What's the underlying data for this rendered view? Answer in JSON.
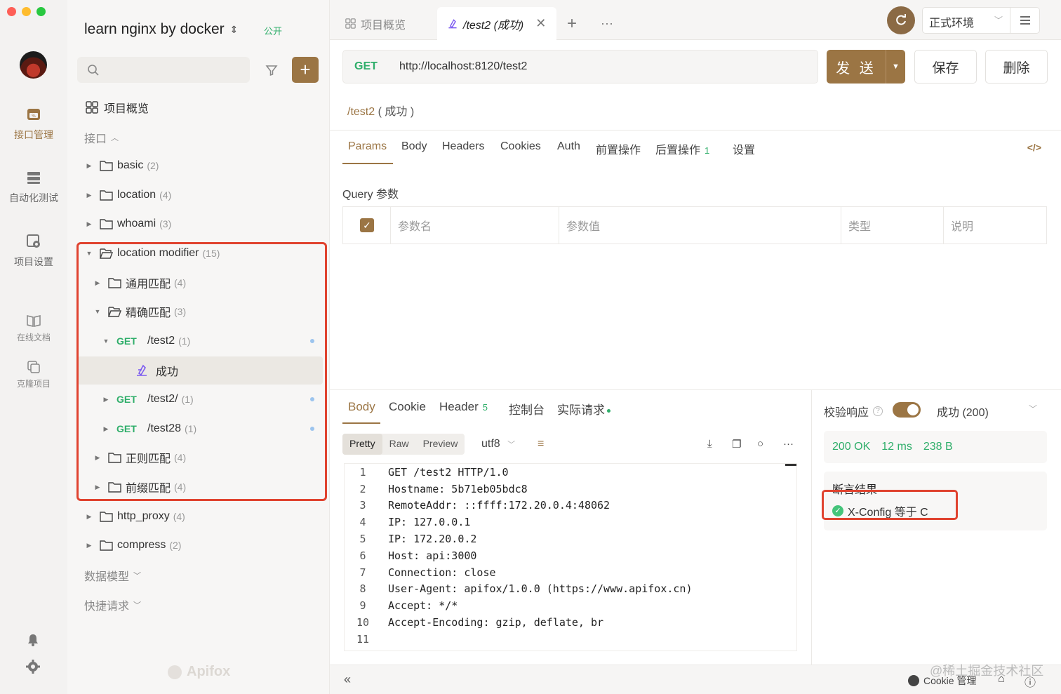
{
  "rail": {
    "items": [
      {
        "label": "接口管理",
        "icon": "api-management-icon",
        "active": true
      },
      {
        "label": "自动化测试",
        "icon": "automation-test-icon"
      },
      {
        "label": "项目设置",
        "icon": "project-settings-icon"
      },
      {
        "label": "在线文档",
        "icon": "online-docs-icon"
      },
      {
        "label": "克隆项目",
        "icon": "clone-project-icon"
      }
    ]
  },
  "sidebar": {
    "project_title": "learn nginx by docker",
    "visibility": "公开",
    "overview": "项目概览",
    "interfaces_label": "接口",
    "tree": [
      {
        "type": "folder",
        "name": "basic",
        "count": "(2)"
      },
      {
        "type": "folder",
        "name": "location",
        "count": "(4)"
      },
      {
        "type": "folder",
        "name": "whoami",
        "count": "(3)"
      },
      {
        "type": "folder",
        "name": "location modifier",
        "count": "(15)"
      },
      {
        "type": "folder",
        "name": "通用匹配",
        "count": "(4)"
      },
      {
        "type": "folder",
        "name": "精确匹配",
        "count": "(3)"
      },
      {
        "type": "api",
        "method": "GET",
        "name": "/test2",
        "count": "(1)"
      },
      {
        "type": "case",
        "name": "成功"
      },
      {
        "type": "api",
        "method": "GET",
        "name": "/test2/",
        "count": "(1)"
      },
      {
        "type": "api",
        "method": "GET",
        "name": "/test28",
        "count": "(1)"
      },
      {
        "type": "folder",
        "name": "正则匹配",
        "count": "(4)"
      },
      {
        "type": "folder",
        "name": "前缀匹配",
        "count": "(4)"
      },
      {
        "type": "folder",
        "name": "http_proxy",
        "count": "(4)"
      },
      {
        "type": "folder",
        "name": "compress",
        "count": "(2)"
      }
    ],
    "data_models": "数据模型",
    "quick_requests": "快捷请求",
    "brand": "Apifox"
  },
  "tabs": [
    {
      "label": "项目概览"
    },
    {
      "label": "/test2 (成功)"
    }
  ],
  "env": {
    "label": "正式环境"
  },
  "request": {
    "method": "GET",
    "url": "http://localhost:8120/test2",
    "send": "发 送",
    "save": "保存",
    "delete": "删除",
    "breadcrumb_path": "/test2",
    "breadcrumb_case": "( 成功 )",
    "tabs": [
      {
        "label": "Params"
      },
      {
        "label": "Body"
      },
      {
        "label": "Headers"
      },
      {
        "label": "Cookies"
      },
      {
        "label": "Auth"
      },
      {
        "label": "前置操作"
      },
      {
        "label": "后置操作",
        "badge": "1"
      },
      {
        "label": "设置"
      }
    ],
    "query_label": "Query 参数",
    "query_columns": [
      "参数名",
      "参数值",
      "类型",
      "说明"
    ]
  },
  "response": {
    "tabs": [
      {
        "label": "Body"
      },
      {
        "label": "Cookie"
      },
      {
        "label": "Header",
        "badge": "5"
      },
      {
        "label": "控制台"
      },
      {
        "label": "实际请求"
      }
    ],
    "formats": [
      "Pretty",
      "Raw",
      "Preview"
    ],
    "encoding": "utf8",
    "lines": [
      "GET /test2 HTTP/1.0",
      "Hostname: 5b71eb05bdc8",
      "RemoteAddr: ::ffff:172.20.0.4:48062",
      "IP: 127.0.0.1",
      "IP: 172.20.0.2",
      "Host: api:3000",
      "Connection: close",
      "User-Agent: apifox/1.0.0 (https://www.apifox.cn)",
      "Accept: */*",
      "Accept-Encoding: gzip, deflate, br",
      ""
    ],
    "verify_label": "校验响应",
    "status_select": "成功 (200)",
    "status_code": "200 OK",
    "time": "12 ms",
    "size": "238 B",
    "assert_title": "断言结果",
    "assert_item": "X-Config 等于 C"
  },
  "statusbar": {
    "cookie_label": "Cookie 管理",
    "watermark": "@稀土掘金技术社区"
  },
  "colors": {
    "accent": "#9b7544",
    "get": "#2fae6a",
    "highlight": "#e0432f"
  }
}
